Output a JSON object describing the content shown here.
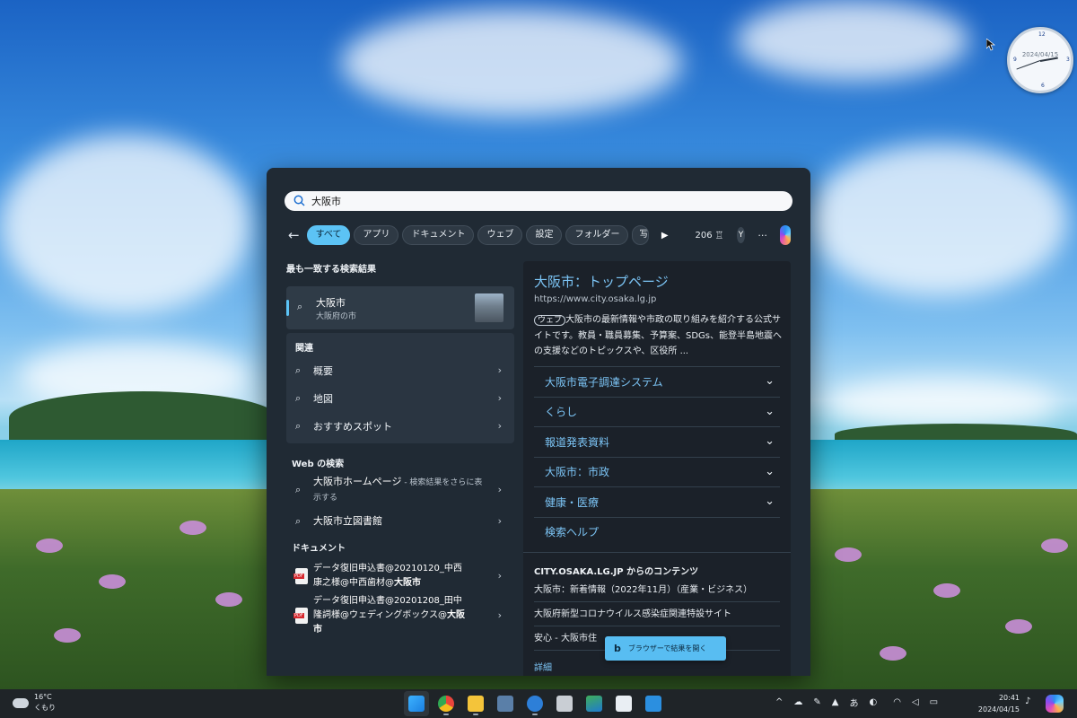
{
  "desktop": {
    "clock_date": "2024/04/15",
    "clock_marks": [
      "12",
      "3",
      "6",
      "9"
    ]
  },
  "search": {
    "query": "大阪市",
    "filters": [
      "すべて",
      "アプリ",
      "ドキュメント",
      "ウェブ",
      "設定",
      "フォルダー",
      "写真"
    ],
    "points": "206",
    "avatar_initial": "Y",
    "more": "···"
  },
  "left": {
    "best_heading": "最も一致する検索結果",
    "best_title": "大阪市",
    "best_subtitle": "大阪府の市",
    "related_heading": "関連",
    "related_items": [
      "概要",
      "地図",
      "おすすめスポット"
    ],
    "web_heading": "Web の検索",
    "web_items": [
      {
        "label": "大阪市ホームページ",
        "sub": " - 検索結果をさらに表示する"
      },
      {
        "label": "大阪市立図書館",
        "sub": ""
      }
    ],
    "docs_heading": "ドキュメント",
    "docs": [
      {
        "line1": "データ復旧申込書@20210120_中西",
        "line2a": "康之様@中西歯材@",
        "line2b": "大阪市"
      },
      {
        "line1": "データ復旧申込書@20201208_田中",
        "line2a": "隆詞様@ウェディングボックス@",
        "line2b": "大阪市"
      }
    ]
  },
  "right": {
    "title": "大阪市：トップページ",
    "url": "https://www.city.osaka.lg.jp",
    "badge": "ウェブ",
    "description": "大阪市の最新情報や市政の取り組みを紹介する公式サイトです。教員・職員募集、予算案、SDGs、能登半島地震への支援などのトピックスや、区役所 ...",
    "links": [
      "大阪市電子調達システム",
      "くらし",
      "報道発表資料",
      "大阪市：市政",
      "健康・医療",
      "検索ヘルプ"
    ],
    "contents_heading": "CITY.OSAKA.LG.JP からのコンテンツ",
    "contents": [
      "大阪市：新着情報（2022年11月）（産業・ビジネス）",
      "大阪府新型コロナウイルス感染症関連特設サイト",
      "安心 - 大阪市住"
    ],
    "more_label": "詳細",
    "browser_button": "ブラウザーで結果を開く"
  },
  "taskbar": {
    "temp": "16°C",
    "weather": "くもり",
    "time": "20:41",
    "date": "2024/04/15",
    "ime": "あ",
    "chevron": "^"
  }
}
